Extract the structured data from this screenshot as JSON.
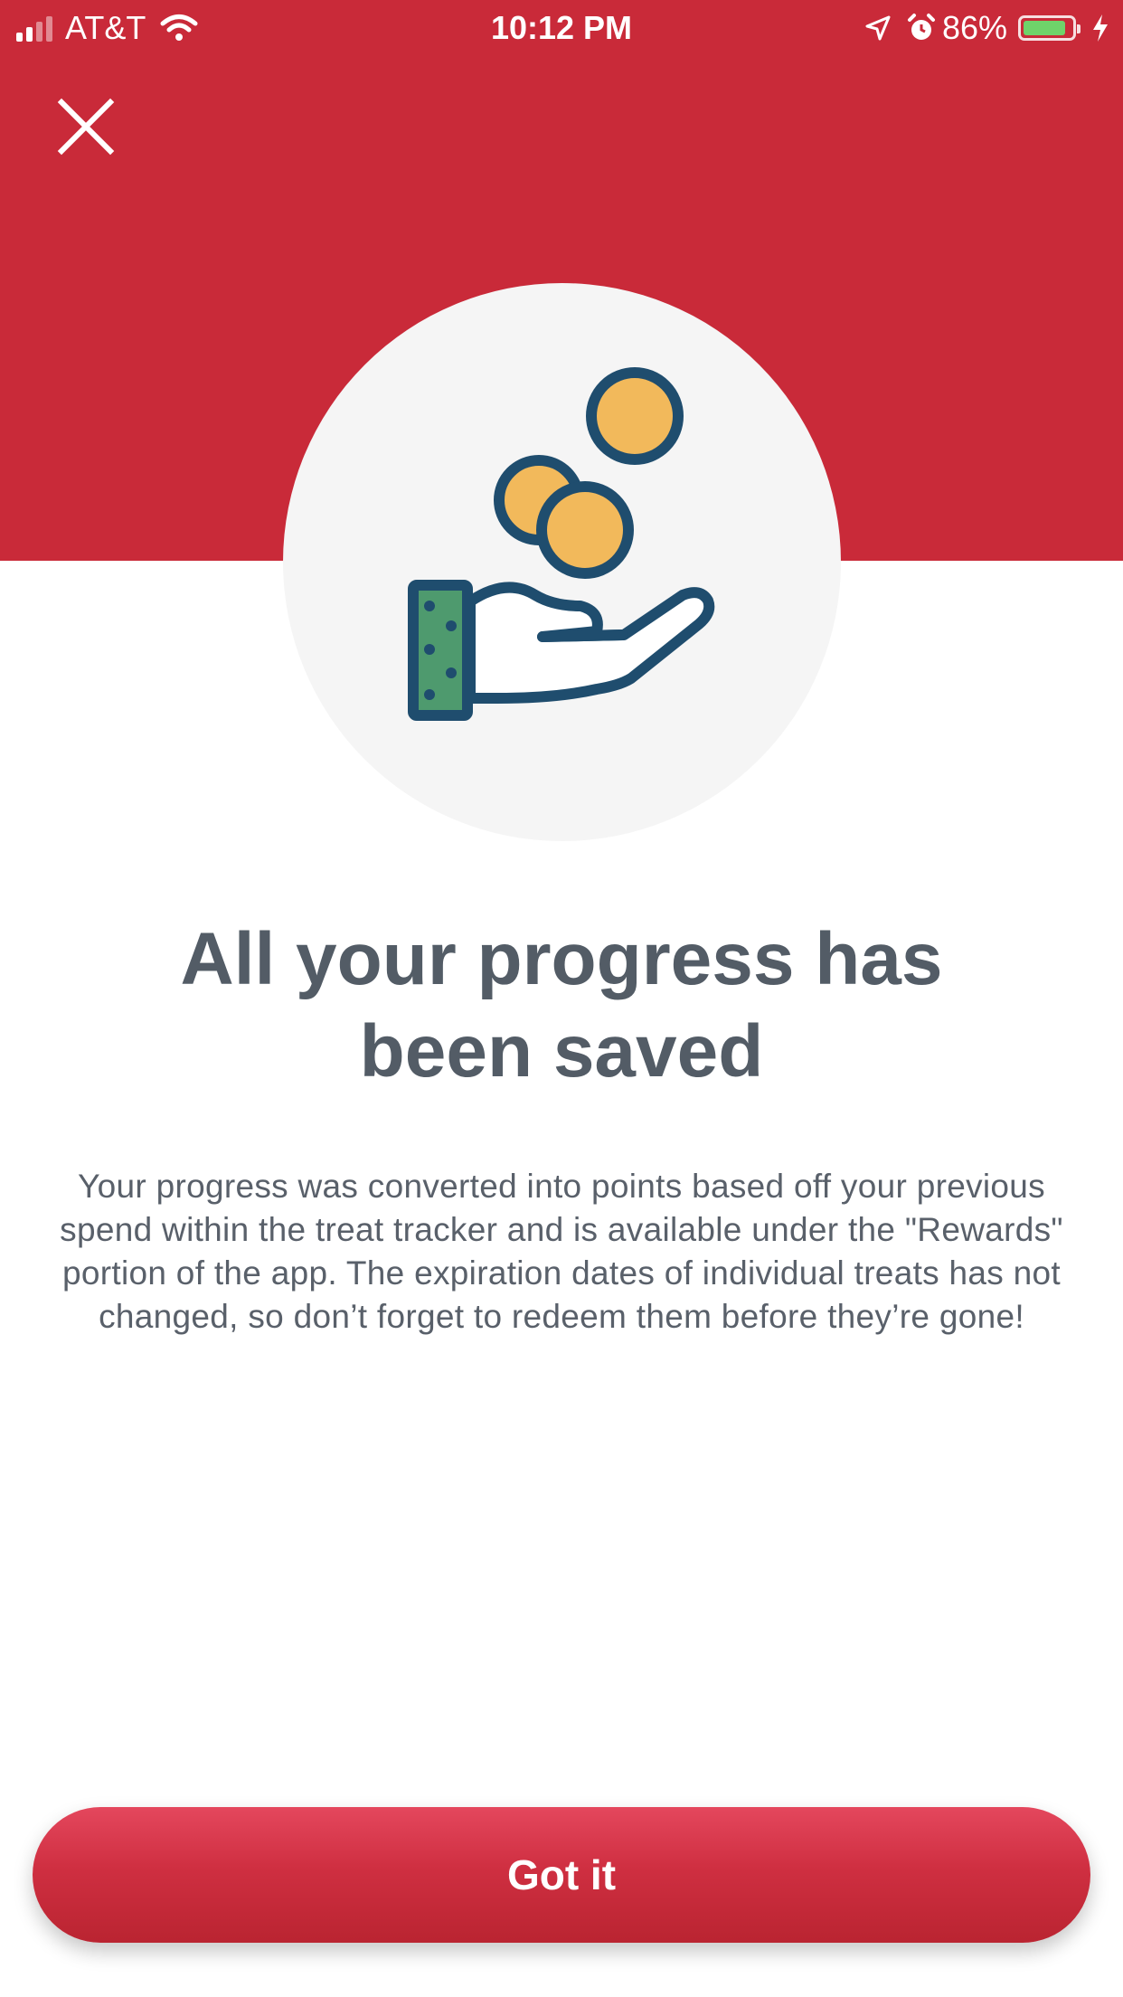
{
  "status_bar": {
    "carrier": "AT&T",
    "time": "10:12 PM",
    "battery_percent": "86%",
    "battery_level": 0.86,
    "icons": [
      "signal-icon",
      "wifi-icon",
      "location-arrow-icon",
      "alarm-icon",
      "battery-icon",
      "charging-bolt-icon"
    ]
  },
  "close_icon": "close-icon",
  "hero": {
    "icon": "hand-coins-icon"
  },
  "title": "All your progress has been saved",
  "description": "Your progress was converted into points based off your previous spend within the treat tracker and is available under the \"Rewards\" portion of the app. The expiration dates of individual treats has not changed, so don’t forget to redeem them before they’re gone!",
  "primary_button": {
    "label": "Got it"
  },
  "colors": {
    "brand_red": "#c92a39",
    "text_gray": "#535c66",
    "coin_yellow": "#f2b95b",
    "icon_navy": "#1f4d6e",
    "money_green": "#4e9a6e"
  }
}
